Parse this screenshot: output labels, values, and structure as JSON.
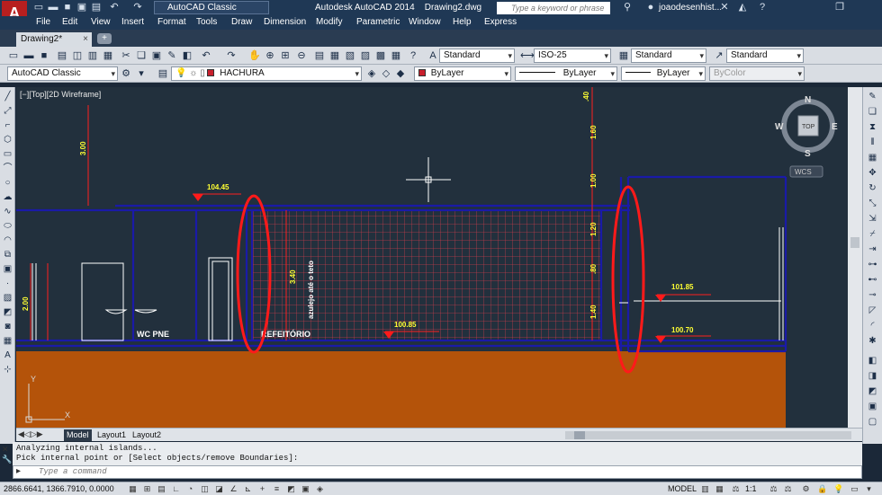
{
  "titlebar": {
    "workspace": "AutoCAD Classic",
    "app_title": "Autodesk AutoCAD 2014    Drawing2.dwg",
    "search_placeholder": "Type a keyword or phrase",
    "user": "joaodesenhist..."
  },
  "menu": [
    "File",
    "Edit",
    "View",
    "Insert",
    "Format",
    "Tools",
    "Draw",
    "Dimension",
    "Modify",
    "Parametric",
    "Window",
    "Help",
    "Express"
  ],
  "tabs": {
    "document": "Drawing2*",
    "new_tab": "+"
  },
  "toolbar": {
    "text_style": "Standard",
    "dim_style": "ISO-25",
    "table_style": "Standard",
    "mleader_style": "Standard",
    "workspace": "AutoCAD Classic",
    "layer": "HACHURA",
    "color": "ByLayer",
    "linetype": "ByLayer",
    "lineweight": "ByLayer",
    "plot_style": "ByColor"
  },
  "viewport": {
    "label": "[−][Top][2D Wireframe]",
    "viewcube": {
      "top": "TOP",
      "north": "N",
      "south": "S",
      "east": "E",
      "west": "W",
      "wcs": "WCS"
    },
    "ucs": {
      "x": "X",
      "y": "Y"
    }
  },
  "drawing": {
    "dimensions": {
      "d300": "3.00",
      "d10445": "104.45",
      "d200": "2.00",
      "d340": "3.40",
      "d10085": "100.85",
      "d40": ".40",
      "d160": "1.60",
      "d100": "1.00",
      "d120": "1.20",
      "d80": ".80",
      "d140": "1.40",
      "d10185": "101.85",
      "d10070": "100.70"
    },
    "note": "azulejo até o teto",
    "room_wc": "WC PNE",
    "room_ref": "REFEITÓRIO"
  },
  "layout_tabs": [
    "Model",
    "Layout1",
    "Layout2"
  ],
  "command": {
    "history": [
      "Analyzing internal islands...",
      "Pick internal point or [Select objects/remove Boundaries]:"
    ],
    "placeholder": "Type a command"
  },
  "status": {
    "coords": "2866.6641, 1366.7910, 0.0000",
    "model": "MODEL",
    "scale": "1:1"
  },
  "colors": {
    "canvas": "#22303d",
    "wall_lines": "#1a1aa8",
    "hatch_grid": "#c23c4a",
    "ground": "#b4530a",
    "dimension_text": "#ffff33",
    "annotation_red": "#ff1a1a",
    "dimension_lines": "#ff2020"
  }
}
